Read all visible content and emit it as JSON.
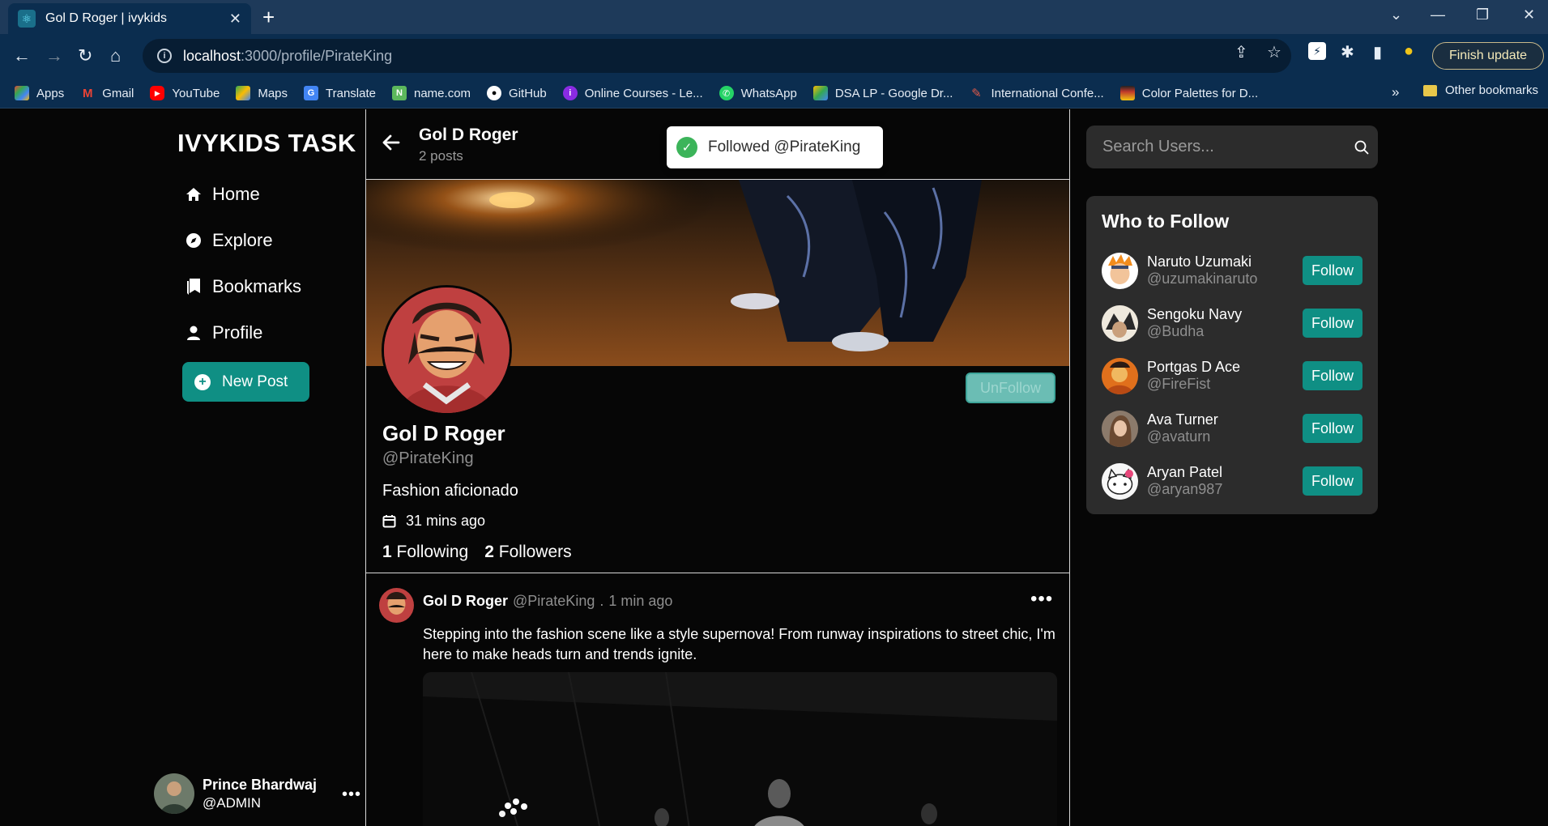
{
  "browser": {
    "tab_title": "Gol D Roger | ivykids",
    "url_host": "localhost",
    "url_path": ":3000/profile/PirateKing",
    "finish_update": "Finish update",
    "bookmarks": [
      {
        "label": "Apps",
        "icon": "apps-grid-icon",
        "color": "#e8453c"
      },
      {
        "label": "Gmail",
        "icon": "gmail-icon",
        "color": "#ea4335"
      },
      {
        "label": "YouTube",
        "icon": "youtube-icon",
        "color": "#ff0000"
      },
      {
        "label": "Maps",
        "icon": "maps-icon",
        "color": "#34a853"
      },
      {
        "label": "Translate",
        "icon": "translate-icon",
        "color": "#4285f4"
      },
      {
        "label": "name.com",
        "icon": "namecom-icon",
        "color": "#5cb85c"
      },
      {
        "label": "GitHub",
        "icon": "github-icon",
        "color": "#ffffff"
      },
      {
        "label": "Online Courses - Le...",
        "icon": "courses-icon",
        "color": "#8a2be2"
      },
      {
        "label": "WhatsApp",
        "icon": "whatsapp-icon",
        "color": "#25d366"
      },
      {
        "label": "DSA LP - Google Dr...",
        "icon": "drive-icon",
        "color": "#fbbc04"
      },
      {
        "label": "International Confe...",
        "icon": "conference-icon",
        "color": "#c0392b"
      },
      {
        "label": "Color Palettes for D...",
        "icon": "palette-icon",
        "color": "#d4a017"
      }
    ],
    "bookmarks_more": "»",
    "other_bookmarks": "Other bookmarks"
  },
  "sidebar": {
    "brand": "IVYKIDS TASK",
    "nav": [
      {
        "label": "Home",
        "icon": "home-icon"
      },
      {
        "label": "Explore",
        "icon": "compass-icon"
      },
      {
        "label": "Bookmarks",
        "icon": "bookmarks-icon"
      },
      {
        "label": "Profile",
        "icon": "person-icon"
      }
    ],
    "new_post": "New Post",
    "current_user": {
      "name": "Prince Bhardwaj",
      "handle": "@ADMIN"
    }
  },
  "header": {
    "name": "Gol D Roger",
    "posts": "2 posts"
  },
  "toast": {
    "text": "Followed @PirateKing"
  },
  "profile": {
    "unfollow_label": "UnFollow",
    "name": "Gol D Roger",
    "handle": "@PirateKing",
    "bio": "Fashion aficionado",
    "joined": "31 mins ago",
    "following_count": "1",
    "following_label": "Following",
    "followers_count": "2",
    "followers_label": "Followers"
  },
  "post": {
    "author": "Gol D Roger",
    "handle": "@PirateKing",
    "sep": ".",
    "time": "1 min ago",
    "text": "Stepping into the fashion scene like a style supernova! From runway inspirations to street chic, I'm here to make heads turn and trends ignite."
  },
  "right": {
    "search_placeholder": "Search Users...",
    "who_to_follow": "Who to Follow",
    "follow_label": "Follow",
    "suggestions": [
      {
        "name": "Naruto Uzumaki",
        "handle": "@uzumakinaruto",
        "avatar_color": "#e88a2a"
      },
      {
        "name": "Sengoku Navy",
        "handle": "@Budha",
        "avatar_color": "#d9d2c4"
      },
      {
        "name": "Portgas D Ace",
        "handle": "@FireFist",
        "avatar_color": "#d4621f"
      },
      {
        "name": "Ava Turner",
        "handle": "@avaturn",
        "avatar_color": "#b88b72"
      },
      {
        "name": "Aryan Patel",
        "handle": "@aryan987",
        "avatar_color": "#f1f1f1"
      }
    ]
  },
  "colors": {
    "accent": "#0f8f84",
    "panel": "#2c2c2c",
    "background": "#060606"
  }
}
